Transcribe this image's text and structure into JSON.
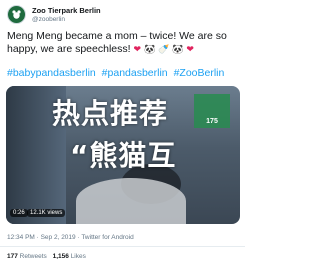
{
  "tweet": {
    "display_name": "Zoo Tierpark Berlin",
    "handle": "@zooberlin",
    "text": "Meng Meng became a mom – twice! We are so happy, we are speechless!",
    "hashtags": [
      "#babypandasberlin",
      "#pandasberlin",
      "#ZooBerlin"
    ],
    "timestamp": "12:34 PM · Sep 2, 2019 · Twitter for Android",
    "retweets": "177",
    "retweets_label": "Retweets",
    "likes": "1,156",
    "likes_label": "Likes"
  },
  "video": {
    "duration": "0:26",
    "views": "12.1K views",
    "badge_text": "175",
    "overlay_line1": "热点推荐",
    "overlay_line2": "“熊猫互"
  },
  "colors": {
    "link": "#1da1f2",
    "secondary_text": "#657786",
    "heart": "#e0245e"
  }
}
